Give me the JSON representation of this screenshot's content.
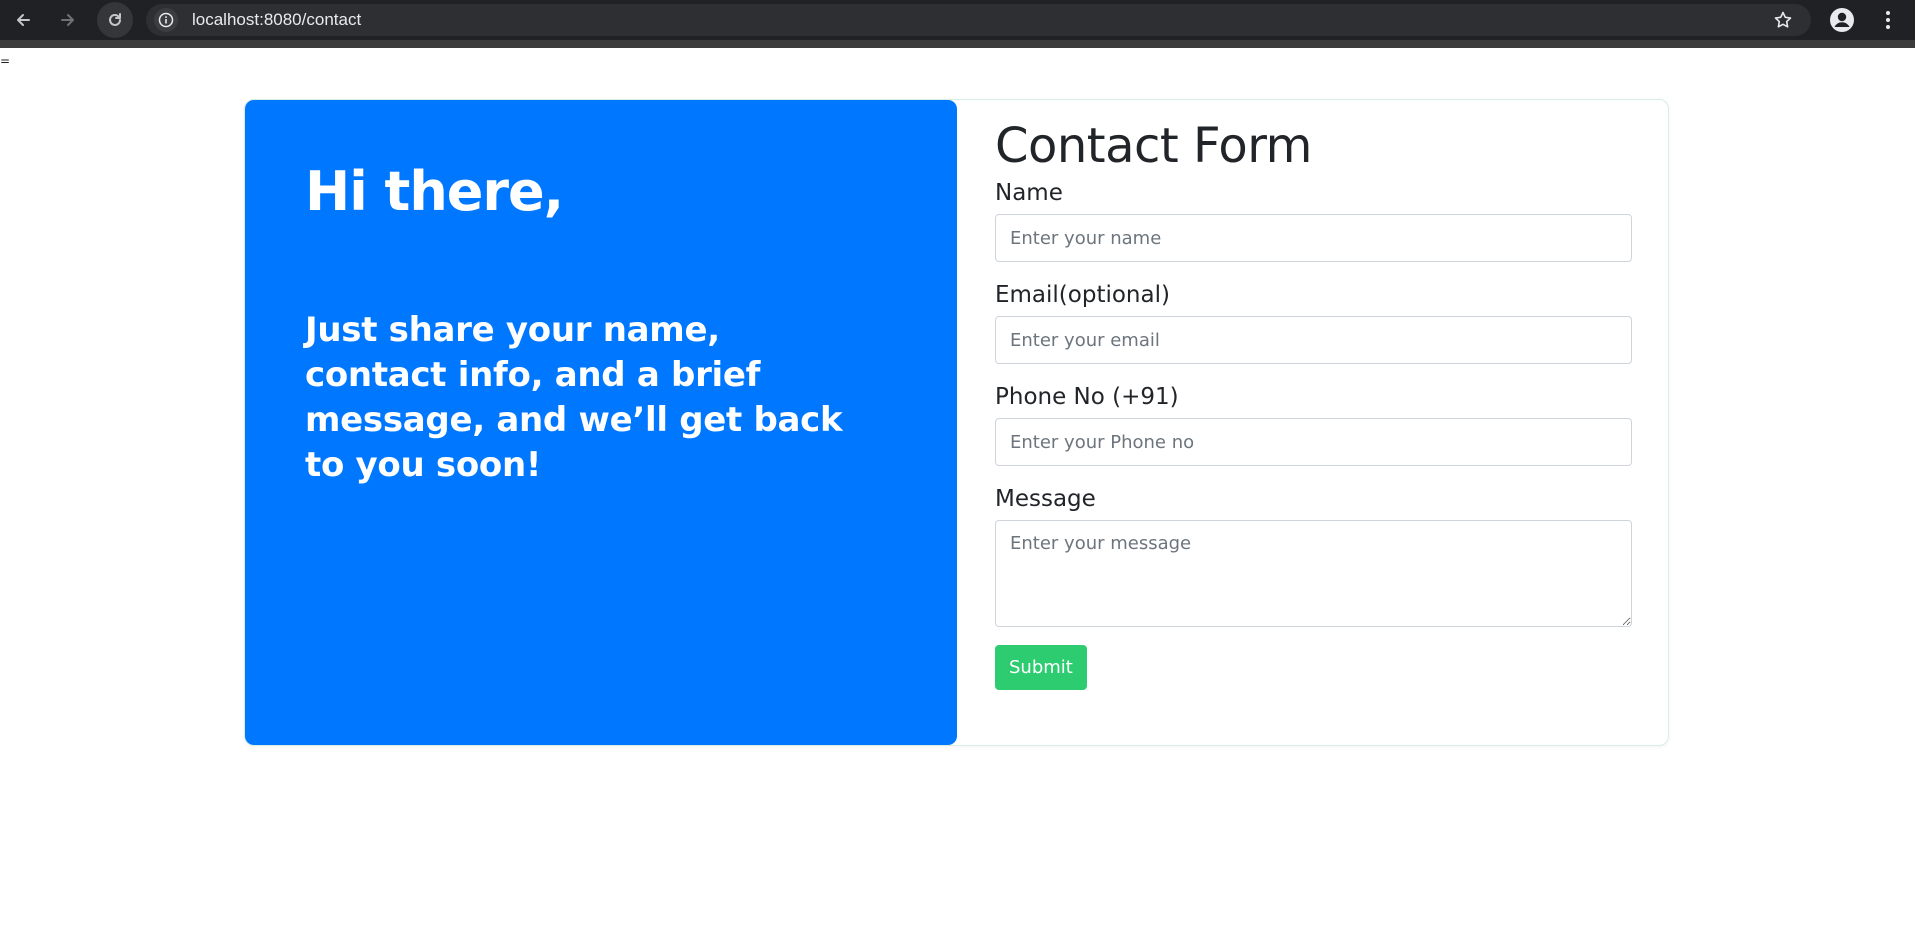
{
  "browser": {
    "url": "localhost:8080/contact",
    "icons": {
      "back": "arrow-left",
      "forward": "arrow-right",
      "reload": "reload",
      "site_info": "info-circle",
      "bookmark": "star-outline",
      "account": "person",
      "menu": "more-vertical"
    }
  },
  "page": {
    "stray_text": "="
  },
  "left": {
    "greeting": "Hi there,",
    "intro": "Just share your name, contact info, and a brief message, and we’ll get back to you soon!",
    "background_color": "#0077ff"
  },
  "form": {
    "title": "Contact Form",
    "fields": [
      {
        "label": "Name",
        "placeholder": "Enter your name",
        "value": ""
      },
      {
        "label": "Email(optional)",
        "placeholder": "Enter your email",
        "value": ""
      },
      {
        "label": "Phone No (+91)",
        "placeholder": "Enter your Phone no",
        "value": ""
      },
      {
        "label": "Message",
        "placeholder": "Enter your message",
        "value": ""
      }
    ],
    "submit_label": "Submit",
    "submit_color": "#2ecc71"
  }
}
